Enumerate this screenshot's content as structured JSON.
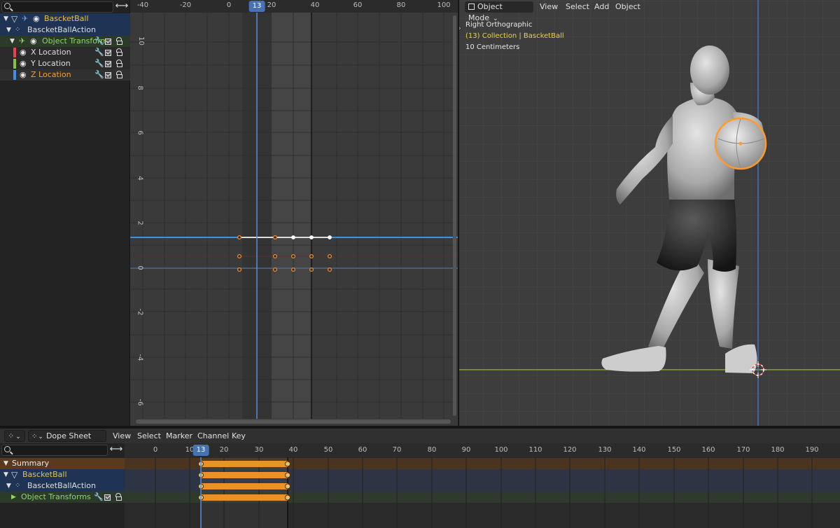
{
  "graph_editor": {
    "search": {
      "placeholder": ""
    },
    "channels": [
      {
        "label": "BascketBall",
        "color": "#e8c04e"
      },
      {
        "label": "BascketBallAction",
        "color": "#dedede"
      },
      {
        "label": "Object Transform",
        "color": "#8fd56a"
      },
      {
        "label": "X Location",
        "color": "#dedede",
        "curve_color": "#e8424f"
      },
      {
        "label": "Y Location",
        "color": "#dedede",
        "curve_color": "#84c43f"
      },
      {
        "label": "Z Location",
        "color": "#f0a040",
        "curve_color": "#3f8fe8"
      }
    ],
    "frame_ticks": [
      "-40",
      "-20",
      "0",
      "20",
      "40",
      "60",
      "80",
      "100"
    ],
    "current_frame": "13",
    "value_ticks": [
      "10",
      "8",
      "6",
      "4",
      "2",
      "0",
      "-2",
      "-4",
      "-6"
    ],
    "icons": [
      "search-icon",
      "swap-icon",
      "pin-icon",
      "eye-icon",
      "wrench-icon",
      "checkbox-icon",
      "lock-icon",
      "action-icon"
    ]
  },
  "viewport": {
    "mode_label": "Object Mode",
    "menu": [
      "View",
      "Select",
      "Add",
      "Object"
    ],
    "view_name": "Right Orthographic",
    "collection_line": "(13) Collection | BascketBall",
    "scale_line": "10 Centimeters",
    "colors": {
      "selection": "#ff9a2e",
      "ground": "#8fb53a",
      "axis": "#3f7fd8"
    }
  },
  "dope_sheet": {
    "editor_label": "Dope Sheet",
    "menu": [
      "View",
      "Select",
      "Marker",
      "Channel",
      "Key"
    ],
    "search": {
      "placeholder": ""
    },
    "frame_ticks": [
      "0",
      "10",
      "20",
      "30",
      "40",
      "50",
      "60",
      "70",
      "80",
      "90",
      "100",
      "110",
      "120",
      "130",
      "140",
      "150",
      "160",
      "170",
      "180",
      "190"
    ],
    "current_frame": "13",
    "channels": [
      {
        "label": "Summary",
        "color": "#e0e0e0"
      },
      {
        "label": "BascketBall",
        "color": "#e8c04e"
      },
      {
        "label": "BascketBallAction",
        "color": "#dedede"
      },
      {
        "label": "Object Transforms",
        "color": "#8fd56a"
      }
    ],
    "keyframe_range": [
      13,
      38
    ],
    "key_color": "#e8922a"
  }
}
